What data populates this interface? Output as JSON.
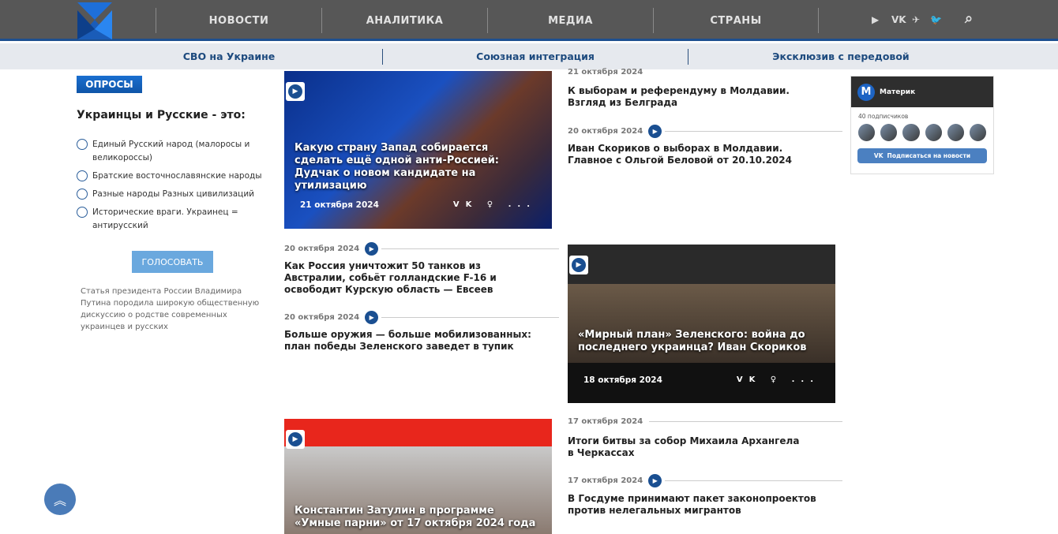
{
  "header": {
    "nav": [
      "НОВОСТИ",
      "АНАЛИТИКА",
      "МЕДИА",
      "СТРАНЫ"
    ],
    "social": [
      "youtube-icon",
      "vk-icon",
      "telegram-icon",
      "twitter-icon"
    ]
  },
  "subnav": [
    "СВО на Украине",
    "Союзная интеграция",
    "Эксклюзив с передовой"
  ],
  "poll": {
    "badge": "ОПРОСЫ",
    "question": "Украинцы и Русские - это:",
    "options": [
      "Единый Русский народ (малоросы и великороссы)",
      "Братские восточнославянские народы",
      "Разные народы Разных цивилизаций",
      "Исторические враги. Украинец = антирусский"
    ],
    "vote": "ГОЛОСОВАТЬ",
    "note": "Статья президента России Владимира Путина породила широкую общественную дискуссию о родстве современных украинцев и русских"
  },
  "cards": [
    {
      "title": "Какую страну Запад собирается сделать ещё одной анти-Россией: Дудчак о новом кандидате на утилизацию",
      "date": "21 октября 2024"
    },
    {
      "title": "«Мирный план» Зеленского: война до последнего украинца? Иван Скориков",
      "date": "18 октября 2024"
    },
    {
      "title": "Константин Затулин в программе «Умные парни» от 17 октября 2024 года"
    }
  ],
  "news": [
    {
      "date": "21 октября 2024",
      "title": "К выборам и референдуму в Молдавии. Взгляд из Белграда"
    },
    {
      "date": "20 октября 2024",
      "title": "Иван Скориков о выборах в Молдавии. Главное с Ольгой Беловой от 20.10.2024"
    },
    {
      "date": "20 октября 2024",
      "title": "Как Россия уничтожит 50 танков из Австралии, собьёт голландские F-16 и освободит Курскую область — Евсеев"
    },
    {
      "date": "20 октября 2024",
      "title": "Больше оружия — больше мобилизованных: план победы Зеленского заведет в тупик"
    },
    {
      "date": "17 октября 2024",
      "title": "Итоги битвы за собор Михаила Архангела в Черкассах"
    },
    {
      "date": "17 октября 2024",
      "title": "В Госдуме принимают пакет законопроектов против нелегальных мигрантов"
    }
  ],
  "widget": {
    "name": "Материк",
    "subs": "40 подписчиков",
    "button": "Подписаться на новости"
  },
  "colors": {
    "header": "#575757",
    "accent": "#1a4f91"
  }
}
